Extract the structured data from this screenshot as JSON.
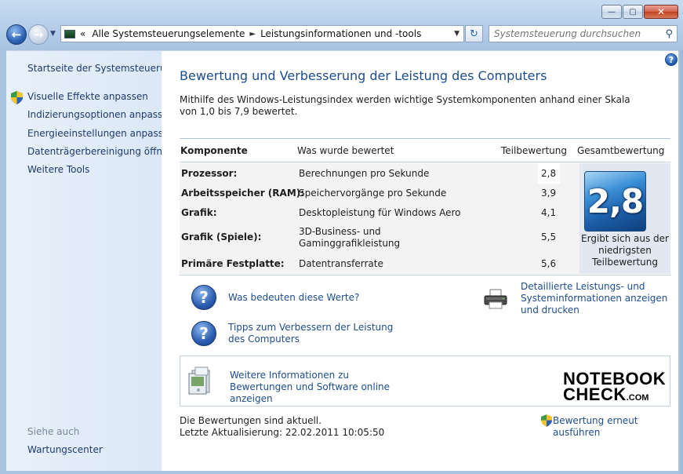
{
  "window": {
    "minimize_label": "—",
    "maximize_label": "▢",
    "close_label": "✕"
  },
  "toolbar": {
    "back_glyph": "←",
    "forward_glyph": "→",
    "history_glyph": "▼",
    "breadcrumb_lead": "«",
    "breadcrumbs": [
      "Alle Systemsteuerungselemente",
      "Leistungsinformationen und -tools"
    ],
    "breadcrumb_separator": "►",
    "dropdown_glyph": "▼",
    "refresh_glyph": "↻",
    "search_placeholder": "Systemsteuerung durchsuchen",
    "search_glyph": "⚲"
  },
  "sidebar": {
    "heading": "Startseite der Systemsteuerung",
    "items": [
      {
        "label": "Visuelle Effekte anpassen",
        "icon": "shield-icon"
      },
      {
        "label": "Indizierungsoptionen anpassen"
      },
      {
        "label": "Energieeinstellungen anpassen"
      },
      {
        "label": "Datenträgerbereinigung öffnen"
      },
      {
        "label": "Weitere Tools"
      }
    ],
    "see_also_heading": "Siehe auch",
    "see_also_items": [
      "Wartungscenter"
    ]
  },
  "main": {
    "help_glyph": "?",
    "title": "Bewertung und Verbesserung der Leistung des Computers",
    "intro": "Mithilfe des Windows-Leistungsindex werden wichtige Systemkomponenten anhand einer Skala von 1,0 bis 7,9 bewertet.",
    "table": {
      "headers": [
        "Komponente",
        "Was wurde bewertet",
        "Teilbewertung",
        "Gesamtbewertung"
      ],
      "rows": [
        {
          "component": "Prozessor:",
          "what": "Berechnungen pro Sekunde",
          "score": "2,8"
        },
        {
          "component": "Arbeitsspeicher (RAM):",
          "what": "Speichervorgänge pro Sekunde",
          "score": "3,9"
        },
        {
          "component": "Grafik:",
          "what": "Desktopleistung für Windows Aero",
          "score": "4,1"
        },
        {
          "component": "Grafik (Spiele):",
          "what": "3D-Business- und Gaminggrafikleistung",
          "score": "5,5"
        },
        {
          "component": "Primäre Festplatte:",
          "what": "Datentransferrate",
          "score": "5,6"
        }
      ],
      "base_score": "2,8",
      "base_score_caption": "Ergibt sich aus der niedrigsten Teilbewertung"
    },
    "links": {
      "what_mean": "Was bedeuten diese Werte?",
      "tips": "Tipps zum Verbessern der Leistung des Computers",
      "details": "Detaillierte Leistungs- und Systeminformationen anzeigen und drucken",
      "question_glyph": "?"
    },
    "info_box": {
      "link": "Weitere Informationen zu Bewertungen und Software online anzeigen",
      "logo_line1": "NOTEBOOK",
      "logo_line2": "CHECK",
      "logo_suffix": ".COM"
    },
    "status": {
      "current": "Die Bewertungen sind aktuell.",
      "last_update": "Letzte Aktualisierung: 22.02.2011 10:05:50"
    },
    "rerun": "Bewertung erneut ausführen"
  },
  "colors": {
    "link": "#1e4d8c",
    "window_chrome": "#b7cfe9",
    "sidebar_bg": "#dbe8f7",
    "badge_blue": "#1d5ea8"
  }
}
